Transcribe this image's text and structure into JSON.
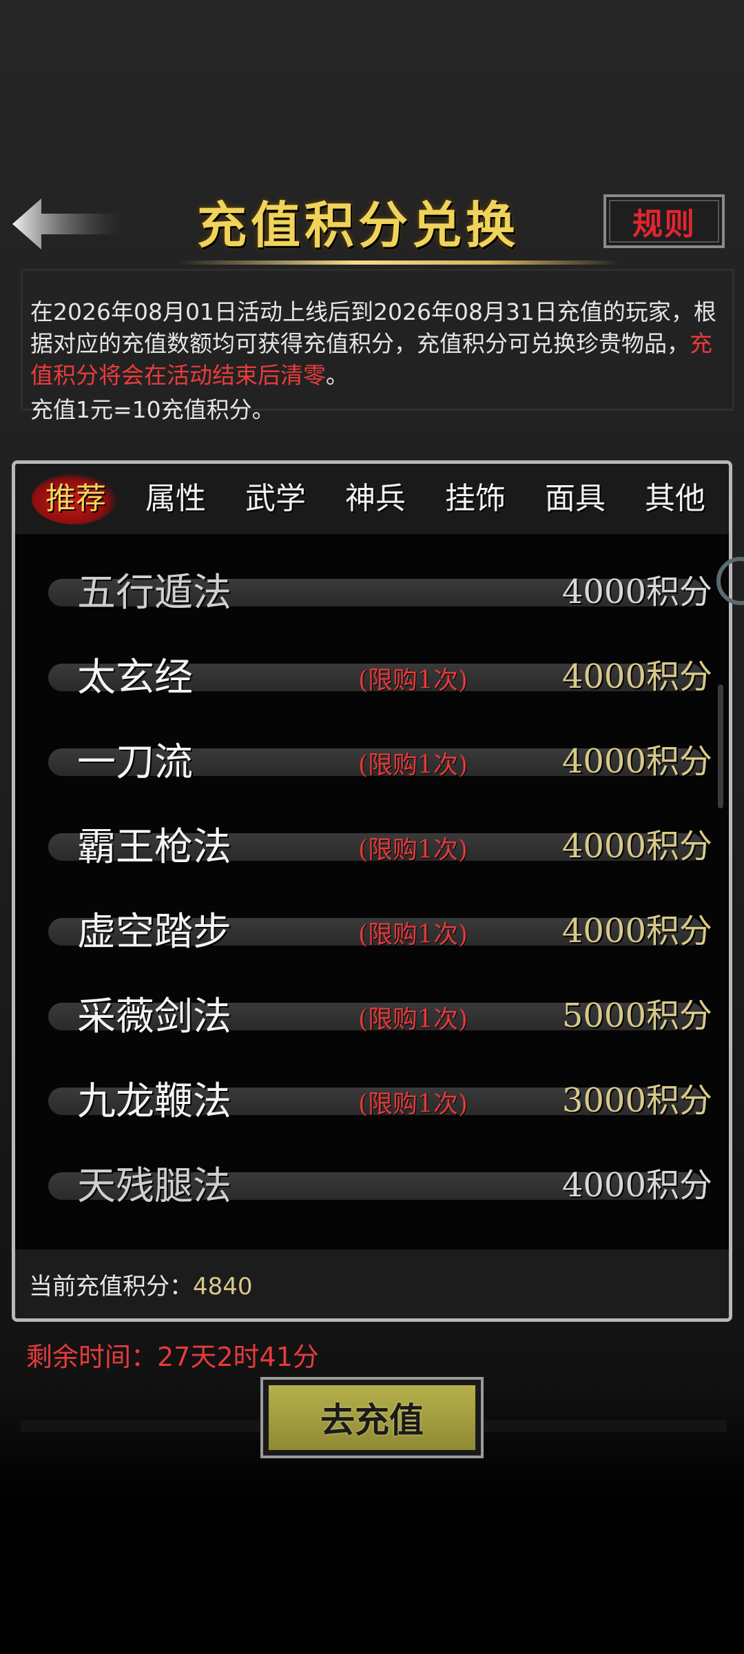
{
  "header": {
    "title": "充值积分兑换",
    "rules_label": "规则"
  },
  "info": {
    "line1": "在2026年08月01日活动上线后到2026年08月31日充值的玩家，根据对应的充值数额均可获得充值积分，充值积分可兑换珍贵物品，",
    "red": "充值积分将会在活动结束后清零",
    "end": "。",
    "line2": "充值1元=10充值积分。"
  },
  "tabs": [
    "推荐",
    "属性",
    "武学",
    "神兵",
    "挂饰",
    "面具",
    "其他"
  ],
  "items": [
    {
      "name": "五行遁法",
      "limit": "",
      "cost": "4000积分"
    },
    {
      "name": "太玄经",
      "limit": "(限购1次)",
      "cost": "4000积分"
    },
    {
      "name": "一刀流",
      "limit": "(限购1次)",
      "cost": "4000积分"
    },
    {
      "name": "霸王枪法",
      "limit": "(限购1次)",
      "cost": "4000积分"
    },
    {
      "name": "虚空踏步",
      "limit": "(限购1次)",
      "cost": "4000积分"
    },
    {
      "name": "采薇剑法",
      "limit": "(限购1次)",
      "cost": "5000积分"
    },
    {
      "name": "九龙鞭法",
      "limit": "(限购1次)",
      "cost": "3000积分"
    },
    {
      "name": "天残腿法",
      "limit": "",
      "cost": "4000积分"
    }
  ],
  "footer": {
    "label": "当前充值积分：",
    "value": "4840"
  },
  "remaining": "剩余时间：27天2时41分",
  "recharge_label": "去充值",
  "colors": {
    "gold": "#f0d35a",
    "red": "#e23a3a",
    "button": "#b6b14c"
  }
}
